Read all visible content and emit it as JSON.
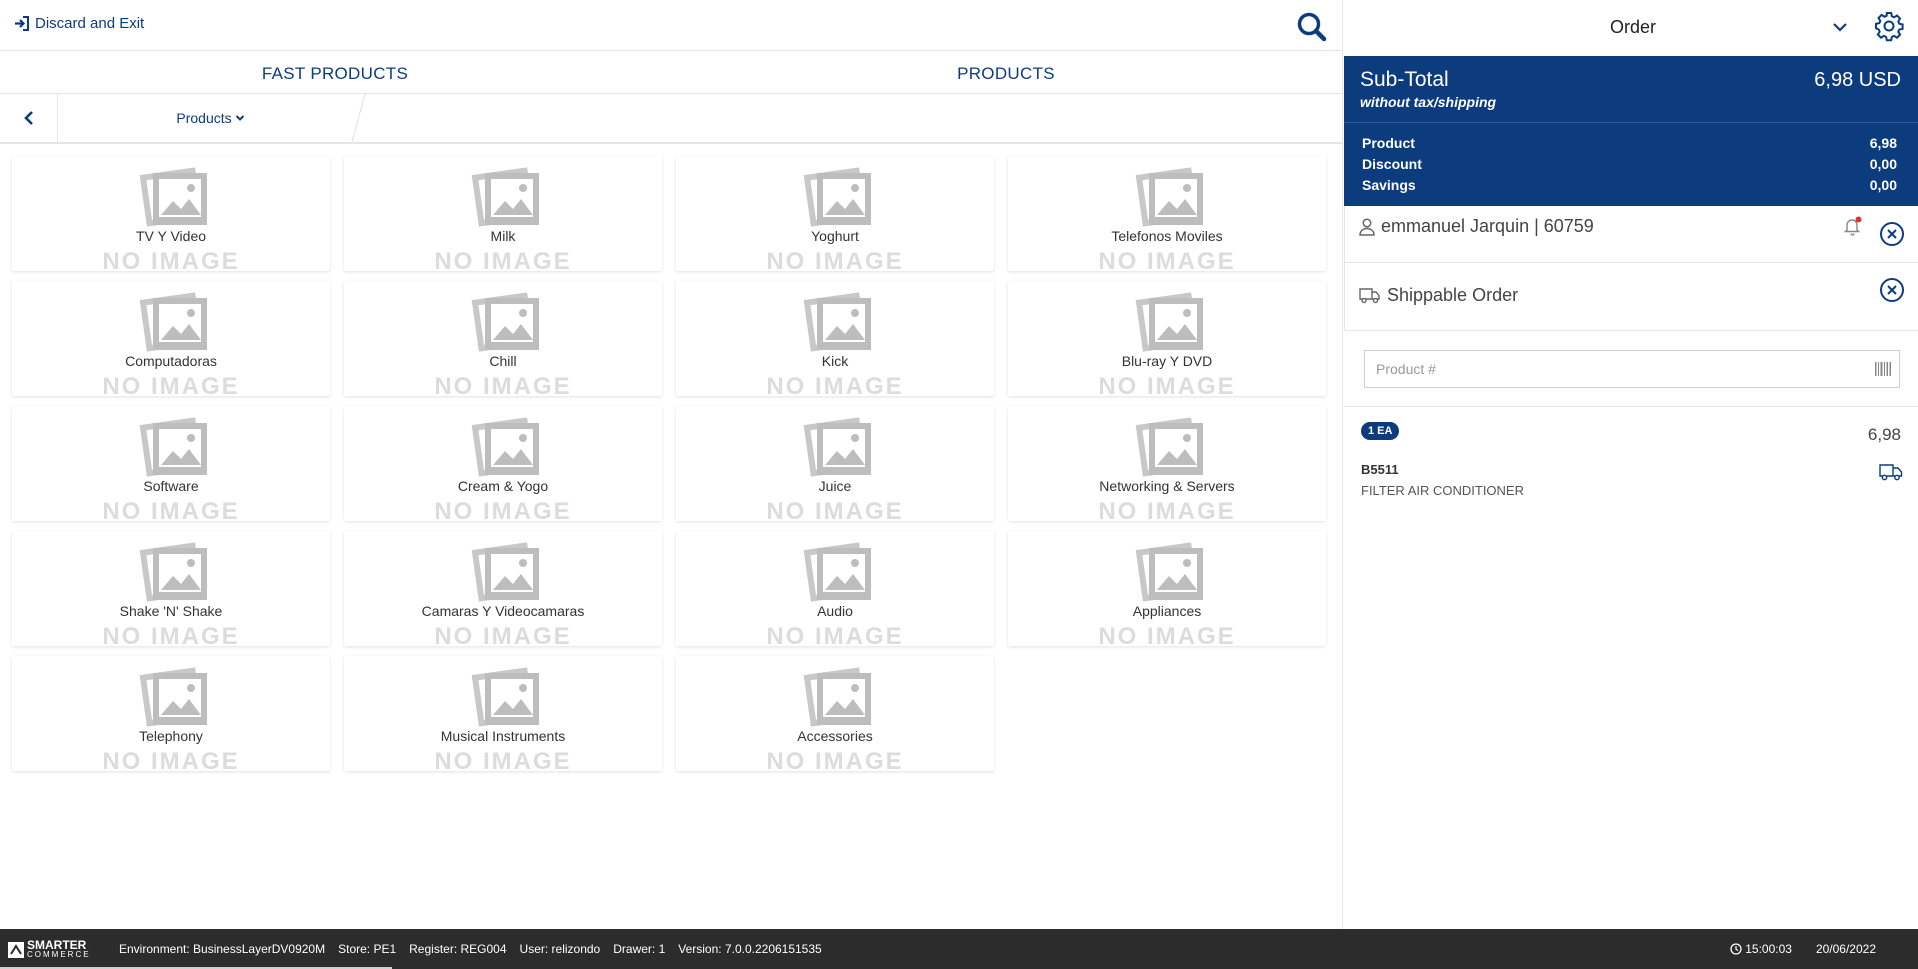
{
  "topbar": {
    "discard_label": "Discard and Exit"
  },
  "tabs": [
    {
      "label": "FAST PRODUCTS"
    },
    {
      "label": "PRODUCTS"
    }
  ],
  "breadcrumb": {
    "label": "Products"
  },
  "tile_noimage": "NO IMAGE",
  "categories": [
    {
      "name": "TV Y Video"
    },
    {
      "name": "Milk"
    },
    {
      "name": "Yoghurt"
    },
    {
      "name": "Telefonos Moviles"
    },
    {
      "name": "Computadoras"
    },
    {
      "name": "Chill"
    },
    {
      "name": "Kick"
    },
    {
      "name": "Blu-ray Y DVD"
    },
    {
      "name": "Software"
    },
    {
      "name": "Cream & Yogo"
    },
    {
      "name": "Juice"
    },
    {
      "name": "Networking & Servers"
    },
    {
      "name": "Shake 'N' Shake"
    },
    {
      "name": "Camaras Y Videocamaras"
    },
    {
      "name": "Audio"
    },
    {
      "name": "Appliances"
    },
    {
      "name": "Telephony"
    },
    {
      "name": "Musical Instruments"
    },
    {
      "name": "Accessories"
    }
  ],
  "order": {
    "title": "Order",
    "subtotal_label": "Sub-Total",
    "subtotal_note": "without tax/shipping",
    "subtotal_amount": "6,98 USD",
    "rows": [
      {
        "label": "Product",
        "value": "6,98"
      },
      {
        "label": "Discount",
        "value": "0,00"
      },
      {
        "label": "Savings",
        "value": "0,00"
      }
    ],
    "customer": "emmanuel Jarquin | 60759",
    "shipping_label": "Shippable Order",
    "product_placeholder": "Product #",
    "line_item": {
      "qty": "1 EA",
      "price": "6,98",
      "sku": "B5511",
      "description": "FILTER AIR CONDITIONER"
    }
  },
  "status": {
    "logo_main": "SMARTER",
    "logo_sub": "COMMERCE",
    "environment": "Environment: BusinessLayerDV0920M",
    "store": "Store: PE1",
    "register": "Register: REG004",
    "user": "User: relizondo",
    "drawer": "Drawer: 1",
    "version": "Version: 7.0.0.2206151535",
    "time": "15:00:03",
    "date": "20/06/2022"
  },
  "colors": {
    "brand": "#0c3c7e",
    "statusbar": "#2c2c2c",
    "alert": "#e03030"
  }
}
